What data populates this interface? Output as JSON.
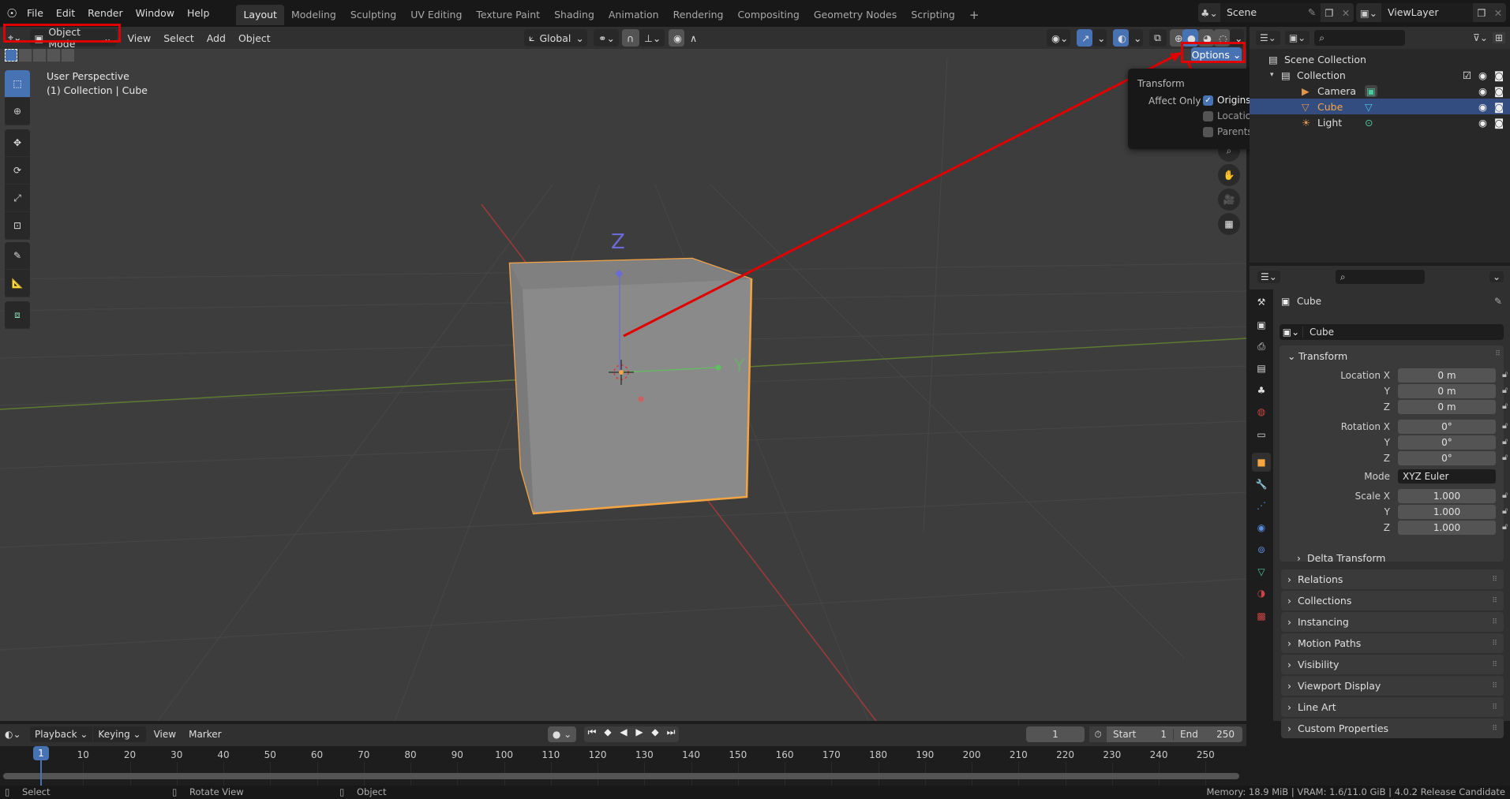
{
  "topbar": {
    "menu": [
      "File",
      "Edit",
      "Render",
      "Window",
      "Help"
    ],
    "workspaces": [
      "Layout",
      "Modeling",
      "Sculpting",
      "UV Editing",
      "Texture Paint",
      "Shading",
      "Animation",
      "Rendering",
      "Compositing",
      "Geometry Nodes",
      "Scripting"
    ],
    "active_workspace": "Layout",
    "add_workspace": "+",
    "scene": "Scene",
    "view_layer": "ViewLayer"
  },
  "viewport_header": {
    "mode": "Object Mode",
    "menus": [
      "View",
      "Select",
      "Add",
      "Object"
    ],
    "orientation": "Global",
    "options_label": "Options"
  },
  "viewport": {
    "perspective_label": "User Perspective",
    "collection_label": "(1) Collection | Cube",
    "axis_z": "Z",
    "axis_y": "Y",
    "accent_orange": "#f5a442",
    "annotation_red": "#e00000"
  },
  "options_popup": {
    "section": "Transform",
    "affect_only_label": "Affect Only",
    "options": [
      {
        "label": "Origins",
        "checked": true
      },
      {
        "label": "Locations",
        "checked": false
      },
      {
        "label": "Parents",
        "checked": false
      }
    ]
  },
  "outliner": {
    "root": "Scene Collection",
    "collection": "Collection",
    "items": [
      {
        "name": "Camera",
        "type": "camera",
        "selected": false
      },
      {
        "name": "Cube",
        "type": "mesh",
        "selected": true
      },
      {
        "name": "Light",
        "type": "light",
        "selected": false
      }
    ]
  },
  "properties": {
    "object_name": "Cube",
    "datablock_name": "Cube",
    "transform_title": "Transform",
    "location": {
      "label": "Location X",
      "x": "0 m",
      "y": "0 m",
      "z": "0 m"
    },
    "rotation": {
      "label": "Rotation X",
      "x": "0°",
      "y": "0°",
      "z": "0°"
    },
    "mode_label": "Mode",
    "mode_value": "XYZ Euler",
    "scale": {
      "label": "Scale X",
      "x": "1.000",
      "y": "1.000",
      "z": "1.000"
    },
    "axis_y": "Y",
    "axis_z": "Z",
    "delta_transform": "Delta Transform",
    "panels": [
      "Relations",
      "Collections",
      "Instancing",
      "Motion Paths",
      "Visibility",
      "Viewport Display",
      "Line Art",
      "Custom Properties"
    ]
  },
  "timeline": {
    "menus": [
      "Playback",
      "Keying",
      "View",
      "Marker"
    ],
    "current_frame": "1",
    "start_label": "Start",
    "start_value": "1",
    "end_label": "End",
    "end_value": "250",
    "ticks": [
      "10",
      "20",
      "30",
      "40",
      "50",
      "60",
      "70",
      "80",
      "90",
      "100",
      "110",
      "120",
      "130",
      "140",
      "150",
      "160",
      "170",
      "180",
      "190",
      "200",
      "210",
      "220",
      "230",
      "240",
      "250"
    ],
    "playhead": "1"
  },
  "statusbar": {
    "select": "Select",
    "rotate": "Rotate View",
    "object": "Object",
    "info": "Memory: 18.9 MiB | VRAM: 1.6/11.0 GiB | 4.0.2 Release Candidate"
  }
}
